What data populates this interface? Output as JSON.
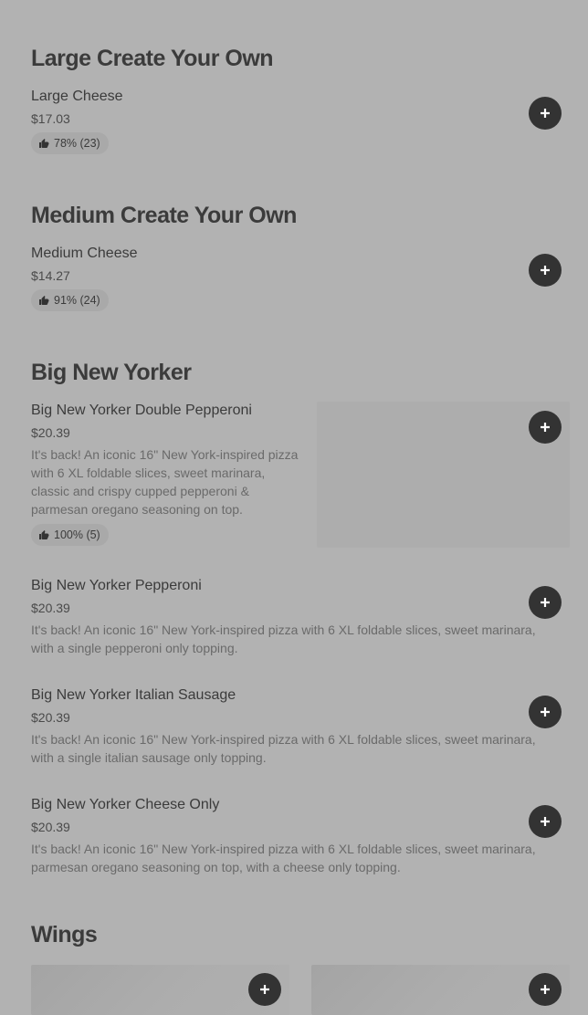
{
  "sections": [
    {
      "title": "Large Create Your Own",
      "items": [
        {
          "name": "Large Cheese",
          "price": "$17.03",
          "rating": "78% (23)"
        }
      ]
    },
    {
      "title": "Medium Create Your Own",
      "items": [
        {
          "name": "Medium Cheese",
          "price": "$14.27",
          "rating": "91% (24)"
        }
      ]
    },
    {
      "title": "Big New Yorker",
      "items": [
        {
          "name": "Big New Yorker Double Pepperoni",
          "price": "$20.39",
          "description": "It's back! An iconic 16\" New York-inspired pizza with 6 XL foldable slices, sweet marinara, classic and crispy cupped pepperoni & parmesan oregano seasoning on top.",
          "rating": "100% (5)"
        },
        {
          "name": "Big New Yorker Pepperoni",
          "price": "$20.39",
          "description": "It's back! An iconic 16\" New York-inspired pizza with 6 XL foldable slices, sweet marinara, with a single pepperoni only topping."
        },
        {
          "name": "Big New Yorker Italian Sausage",
          "price": "$20.39",
          "description": "It's back! An iconic 16\" New York-inspired pizza with 6 XL foldable slices, sweet marinara, with a single italian sausage only topping."
        },
        {
          "name": "Big New Yorker Cheese Only",
          "price": "$20.39",
          "description": "It's back! An iconic 16\" New York-inspired pizza with 6 XL foldable slices, sweet marinara, parmesan oregano seasoning on top, with a cheese only topping."
        }
      ]
    },
    {
      "title": "Wings",
      "items": []
    }
  ],
  "icons": {
    "add": "plus-icon",
    "rating": "thumbs-up-icon"
  },
  "colors": {
    "background": "#b2b2b2",
    "add_button": "#333333",
    "rating_pill": "#a9a9a9"
  }
}
